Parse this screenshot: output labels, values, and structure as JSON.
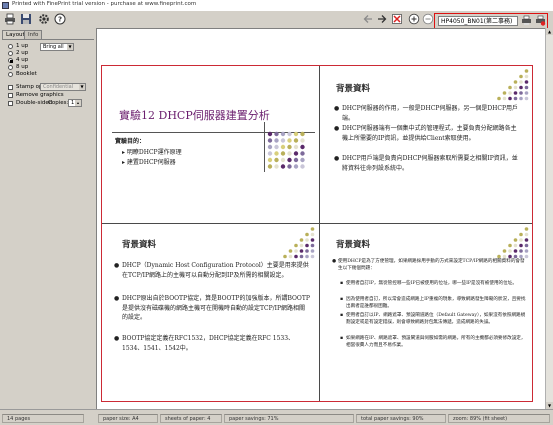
{
  "window": {
    "title": "Printed with FinePrint trial version - purchase at www.fineprint.com"
  },
  "printer": {
    "name": "HP4050_BN01(第二事務)"
  },
  "tabs": [
    "Layout",
    "Info"
  ],
  "layout": {
    "pages_options": [
      "1 up",
      "2 up",
      "4 up",
      "8 up",
      "Booklet"
    ],
    "selected": "4 up",
    "dropdown_value": "Bring all",
    "stamp_label": "Stamp opt",
    "stamp_dropdown": "Confidential",
    "remove_graphics_label": "Remove graphics",
    "double_sided_label": "Double-sided",
    "copies_label": "Copies:",
    "copies_value": "1"
  },
  "slides": {
    "s1": {
      "title": "實驗12 DHCP伺服器建置分析",
      "subtitle": "實驗目的：",
      "items": [
        "明瞭DHCP運作原理",
        "建置DHCP伺服器"
      ]
    },
    "s2": {
      "title": "背景資料",
      "bullets": [
        "DHCP伺服器的作用，一般是DHCP伺服器，另一個是DHCP用戶端。",
        "DHCP伺服器端有一個集中式的管理程式，主要負責分配網路各主機上所需要的IP資訊，並提供給Client索取使用。",
        "DHCP用戶端是負責向DHCP伺服器索取所需要之相關IP資訊，並將資料往命列設系統中。"
      ]
    },
    "s3": {
      "title": "背景資料",
      "bullets": [
        "DHCP（Dynamic Host Configuration Protocol）主要是用來提供在TCP/IP網路上的主機可以自動分配到IP及所需的相關設定。",
        "DHCP原出自於BOOTP協定，算是BOOTP的加強版本，所謂BOOTP是提供沒有磁碟機的網路主機可在開機時自動的設定TCP/IP網路相關的設定。",
        "BOOTP協定定義在RFC1532，DHCP協定定義在RFC 1533、1534、1541、1542中。"
      ]
    },
    "s4": {
      "title": "背景資料",
      "intro": "使用DHCP是為了方便管理，如果網路採用手動的方式來設定TCP/IP網路的相關資料的會發生以下幾個問題：",
      "sub": [
        "使用者自訂IP，無從管控哪一些IP已被使用的位址，哪一些IP是沒有被使用的位址。",
        "因為使用者自訂，所以常會造成網路上IP重複的現象，導致網路發生障礙的狀況，且要找出兩者是誰都很困難。",
        "使用者自訂以IP、網路遮罩、預設閘道路位（Default Gateway），如果沒有依照網路規劃設定或是有設定錯誤，則會導致網路封包無法傳遞，造成網路的失誤。",
        "如果網路在IP、網路遮罩、預設閘道與伺服如需的網路，所有的主機都必須要修改設定，相當很費人力而且不易作業。"
      ]
    }
  },
  "status": {
    "pages": "14 pages",
    "paper_size": "paper size: A4",
    "sheets": "sheets of paper: 4",
    "paper_savings": "paper savings: 71%",
    "total_paper_savings": "total paper savings: 90%",
    "zoom": "zoom: 89% (fit sheet)"
  },
  "icons": {
    "toolbar_left": [
      "printer-icon",
      "save-icon",
      "settings-icon",
      "help-icon"
    ],
    "toolbar_right": [
      "back-arrow-icon",
      "forward-arrow-icon",
      "delete-page-icon",
      "zoom-in-icon",
      "zoom-out-icon",
      "printer-status-icon",
      "printer-alert-icon"
    ]
  },
  "colors": {
    "sheet_border": "#cc2a35",
    "slide_title": "#6b1e6e",
    "highlight_box": "#dd1111"
  }
}
